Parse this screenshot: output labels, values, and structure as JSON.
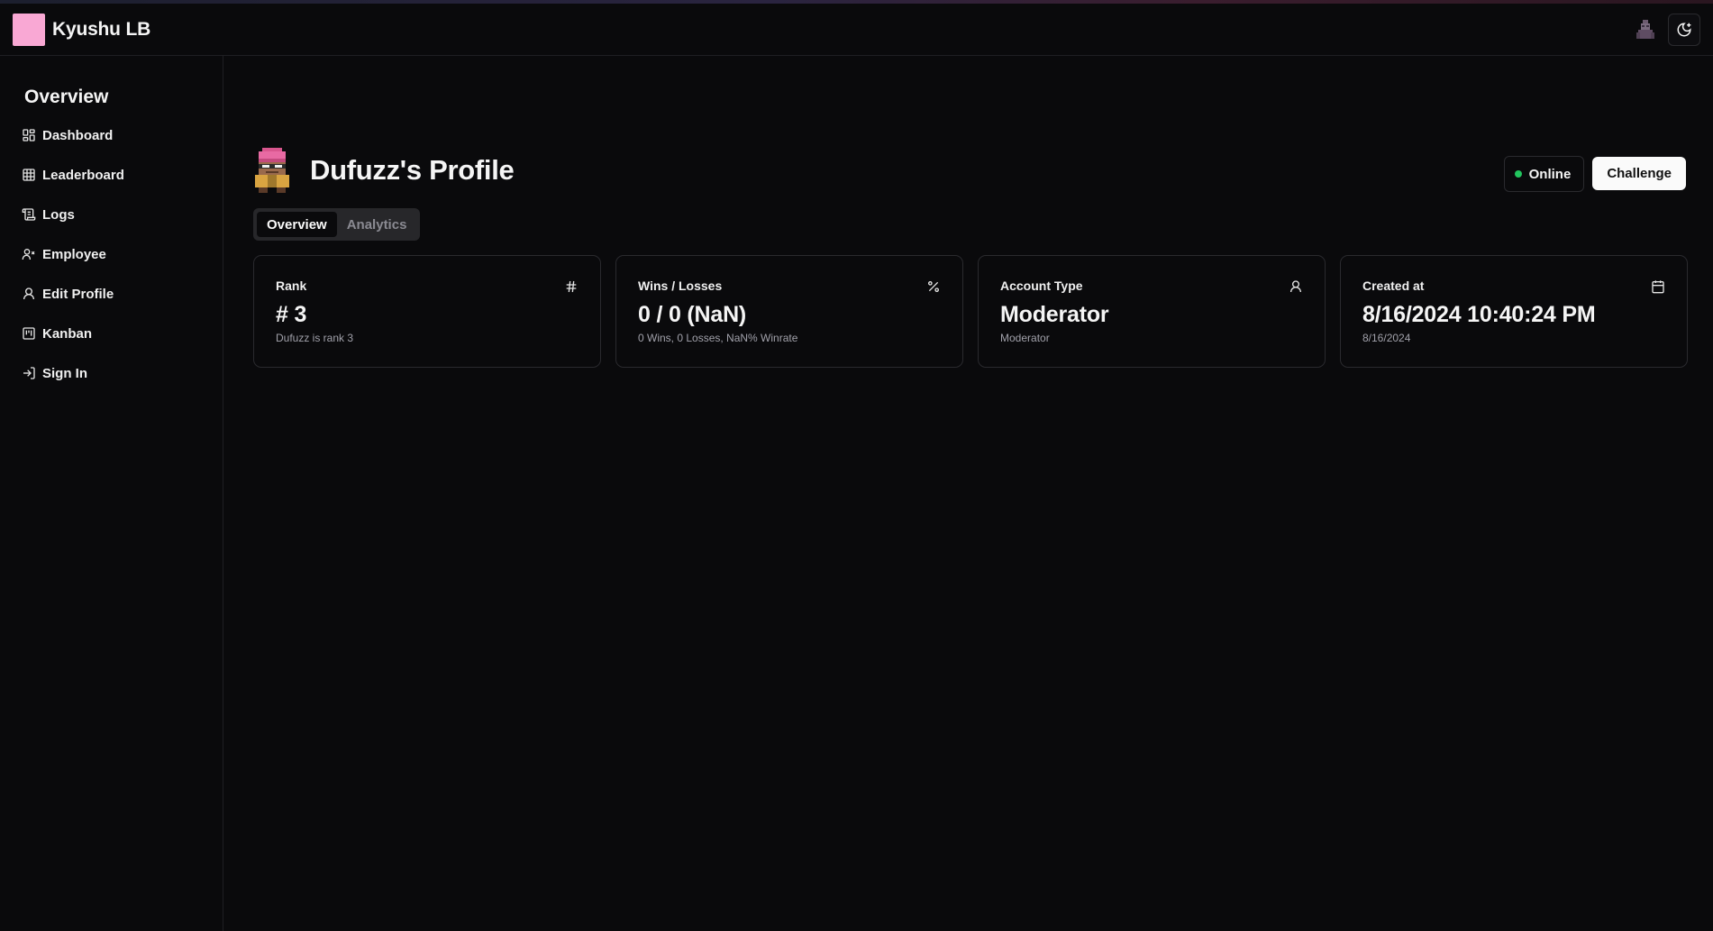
{
  "app": {
    "brand": "Kyushu LB"
  },
  "sidebar": {
    "title": "Overview",
    "items": [
      {
        "label": "Dashboard",
        "icon": "dashboard-icon"
      },
      {
        "label": "Leaderboard",
        "icon": "table-icon"
      },
      {
        "label": "Logs",
        "icon": "scroll-icon"
      },
      {
        "label": "Employee",
        "icon": "user-x-icon"
      },
      {
        "label": "Edit Profile",
        "icon": "user-icon"
      },
      {
        "label": "Kanban",
        "icon": "kanban-icon"
      },
      {
        "label": "Sign In",
        "icon": "sign-in-icon"
      }
    ]
  },
  "profile": {
    "title": "Dufuzz's Profile",
    "status": "Online",
    "challenge_label": "Challenge",
    "tabs": [
      {
        "label": "Overview",
        "active": true
      },
      {
        "label": "Analytics",
        "active": false
      }
    ]
  },
  "cards": [
    {
      "label": "Rank",
      "icon": "hash-icon",
      "value": "# 3",
      "sub": "Dufuzz is rank 3"
    },
    {
      "label": "Wins / Losses",
      "icon": "percent-icon",
      "value": "0 / 0 (NaN)",
      "sub": "0 Wins, 0 Losses, NaN% Winrate"
    },
    {
      "label": "Account Type",
      "icon": "user-icon",
      "value": "Moderator",
      "sub": "Moderator"
    },
    {
      "label": "Created at",
      "icon": "calendar-icon",
      "value": "8/16/2024 10:40:24 PM",
      "sub": "8/16/2024"
    }
  ],
  "colors": {
    "background": "#0a0a0c",
    "brand_square": "#f9a8d4",
    "online": "#22c55e"
  }
}
